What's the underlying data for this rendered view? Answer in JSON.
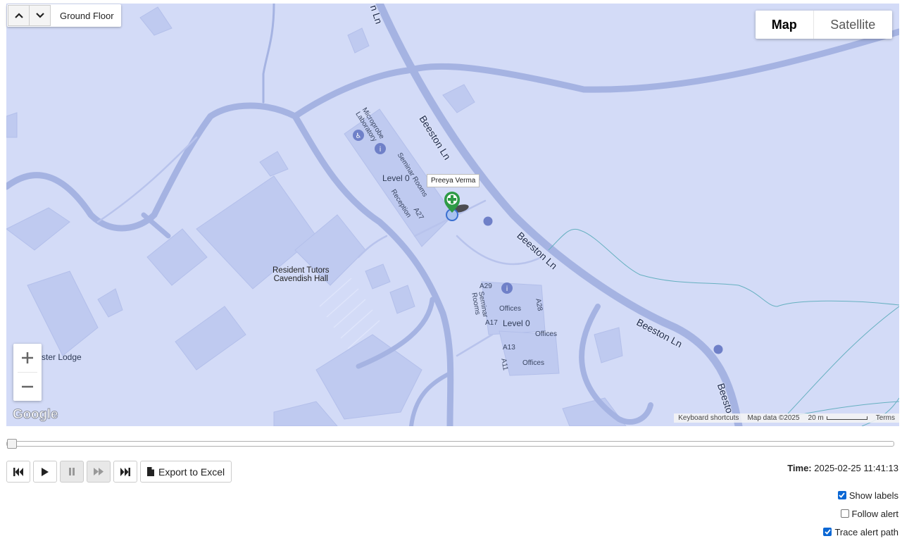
{
  "floor": {
    "label": "Ground Floor"
  },
  "map_type": {
    "map": "Map",
    "satellite": "Satellite",
    "selected": "Map"
  },
  "map": {
    "labels": {
      "lab": "Microprobe\nLaboratory",
      "seminar1": "Seminar Rooms",
      "level0a": "Level 0",
      "reception": "Reception",
      "a27": "A27",
      "beeston1": "Beeston Ln",
      "beeston2": "Beeston Ln",
      "beeston3": "Beeston Ln",
      "beeston4": "Beesto",
      "resident": "Resident Tutors\nCavendish Hall",
      "lodge": "ster Lodge",
      "a29": "A29",
      "seminar2": "Seminar\nRooms",
      "offices1": "Offices",
      "a28": "A28",
      "a17": "A17",
      "level0b": "Level 0",
      "offices2": "Offices",
      "a13": "A13",
      "a11": "A11",
      "offices3": "Offices"
    },
    "marker_tooltip": "Preeya Verma",
    "colors": {
      "background": "#d3dbf7",
      "road": "#a5b3e2",
      "building": "#bfcaf0",
      "marker": "#2e9a45"
    }
  },
  "attribution": {
    "keyboard": "Keyboard shortcuts",
    "data": "Map data ©2025",
    "scale": "20 m",
    "terms": "Terms"
  },
  "logo": "Google",
  "playback": {
    "position": 0,
    "export_label": "Export to Excel"
  },
  "time": {
    "label": "Time:",
    "value": "2025-02-25 11:41:13"
  },
  "options": [
    {
      "label": "Show labels",
      "checked": true
    },
    {
      "label": "Follow alert",
      "checked": false
    },
    {
      "label": "Trace alert path",
      "checked": true
    }
  ]
}
